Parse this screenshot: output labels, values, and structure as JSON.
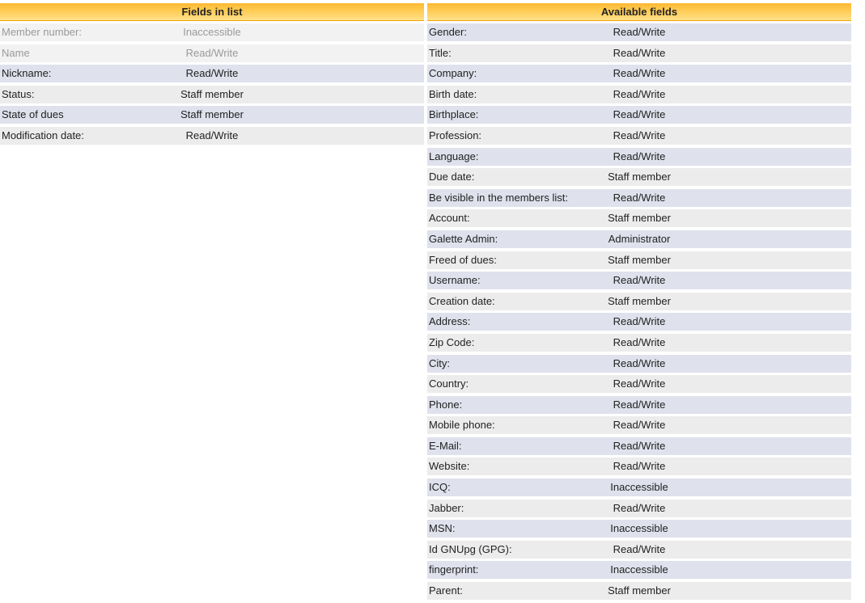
{
  "fields_in_list": {
    "title": "Fields in list",
    "rows": [
      {
        "label": "Member number:",
        "access": "Inaccessible",
        "disabled": true
      },
      {
        "label": "Name",
        "access": "Read/Write",
        "disabled": true
      },
      {
        "label": "Nickname:",
        "access": "Read/Write"
      },
      {
        "label": "Status:",
        "access": "Staff member"
      },
      {
        "label": "State of dues",
        "access": "Staff member"
      },
      {
        "label": "Modification date:",
        "access": "Read/Write"
      }
    ]
  },
  "available_fields": {
    "title": "Available fields",
    "rows": [
      {
        "label": "Gender:",
        "access": "Read/Write"
      },
      {
        "label": "Title:",
        "access": "Read/Write"
      },
      {
        "label": "Company:",
        "access": "Read/Write"
      },
      {
        "label": "Birth date:",
        "access": "Read/Write"
      },
      {
        "label": "Birthplace:",
        "access": "Read/Write"
      },
      {
        "label": "Profession:",
        "access": "Read/Write"
      },
      {
        "label": "Language:",
        "access": "Read/Write"
      },
      {
        "label": "Due date:",
        "access": "Staff member"
      },
      {
        "label": "Be visible in the members list:",
        "access": "Read/Write"
      },
      {
        "label": "Account:",
        "access": "Staff member"
      },
      {
        "label": "Galette Admin:",
        "access": "Administrator"
      },
      {
        "label": "Freed of dues:",
        "access": "Staff member"
      },
      {
        "label": "Username:",
        "access": "Read/Write"
      },
      {
        "label": "Creation date:",
        "access": "Staff member"
      },
      {
        "label": "Address:",
        "access": "Read/Write"
      },
      {
        "label": "Zip Code:",
        "access": "Read/Write"
      },
      {
        "label": "City:",
        "access": "Read/Write"
      },
      {
        "label": "Country:",
        "access": "Read/Write"
      },
      {
        "label": "Phone:",
        "access": "Read/Write"
      },
      {
        "label": "Mobile phone:",
        "access": "Read/Write"
      },
      {
        "label": "E-Mail:",
        "access": "Read/Write"
      },
      {
        "label": "Website:",
        "access": "Read/Write"
      },
      {
        "label": "ICQ:",
        "access": "Inaccessible"
      },
      {
        "label": "Jabber:",
        "access": "Read/Write"
      },
      {
        "label": "MSN:",
        "access": "Inaccessible"
      },
      {
        "label": "Id GNUpg (GPG):",
        "access": "Read/Write"
      },
      {
        "label": "fingerprint:",
        "access": "Inaccessible"
      },
      {
        "label": "Parent:",
        "access": "Staff member"
      }
    ]
  }
}
